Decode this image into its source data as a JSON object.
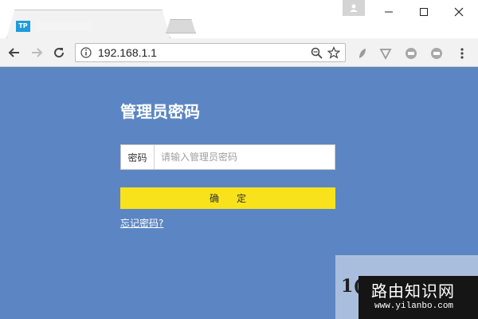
{
  "browser": {
    "tab_favicon_text": "TP",
    "url": "192.168.1.1"
  },
  "login": {
    "title": "管理员密码",
    "password_label": "密码",
    "password_placeholder": "请输入管理员密码",
    "confirm_label": "确定",
    "forgot_link": "忘记密码?"
  },
  "watermark": {
    "partial_text": "1(",
    "chinese": "路由知识网",
    "url": "www.yilanbo.com"
  },
  "colors": {
    "page_bg": "#5b86c3",
    "confirm_bg": "#f7e21c"
  }
}
